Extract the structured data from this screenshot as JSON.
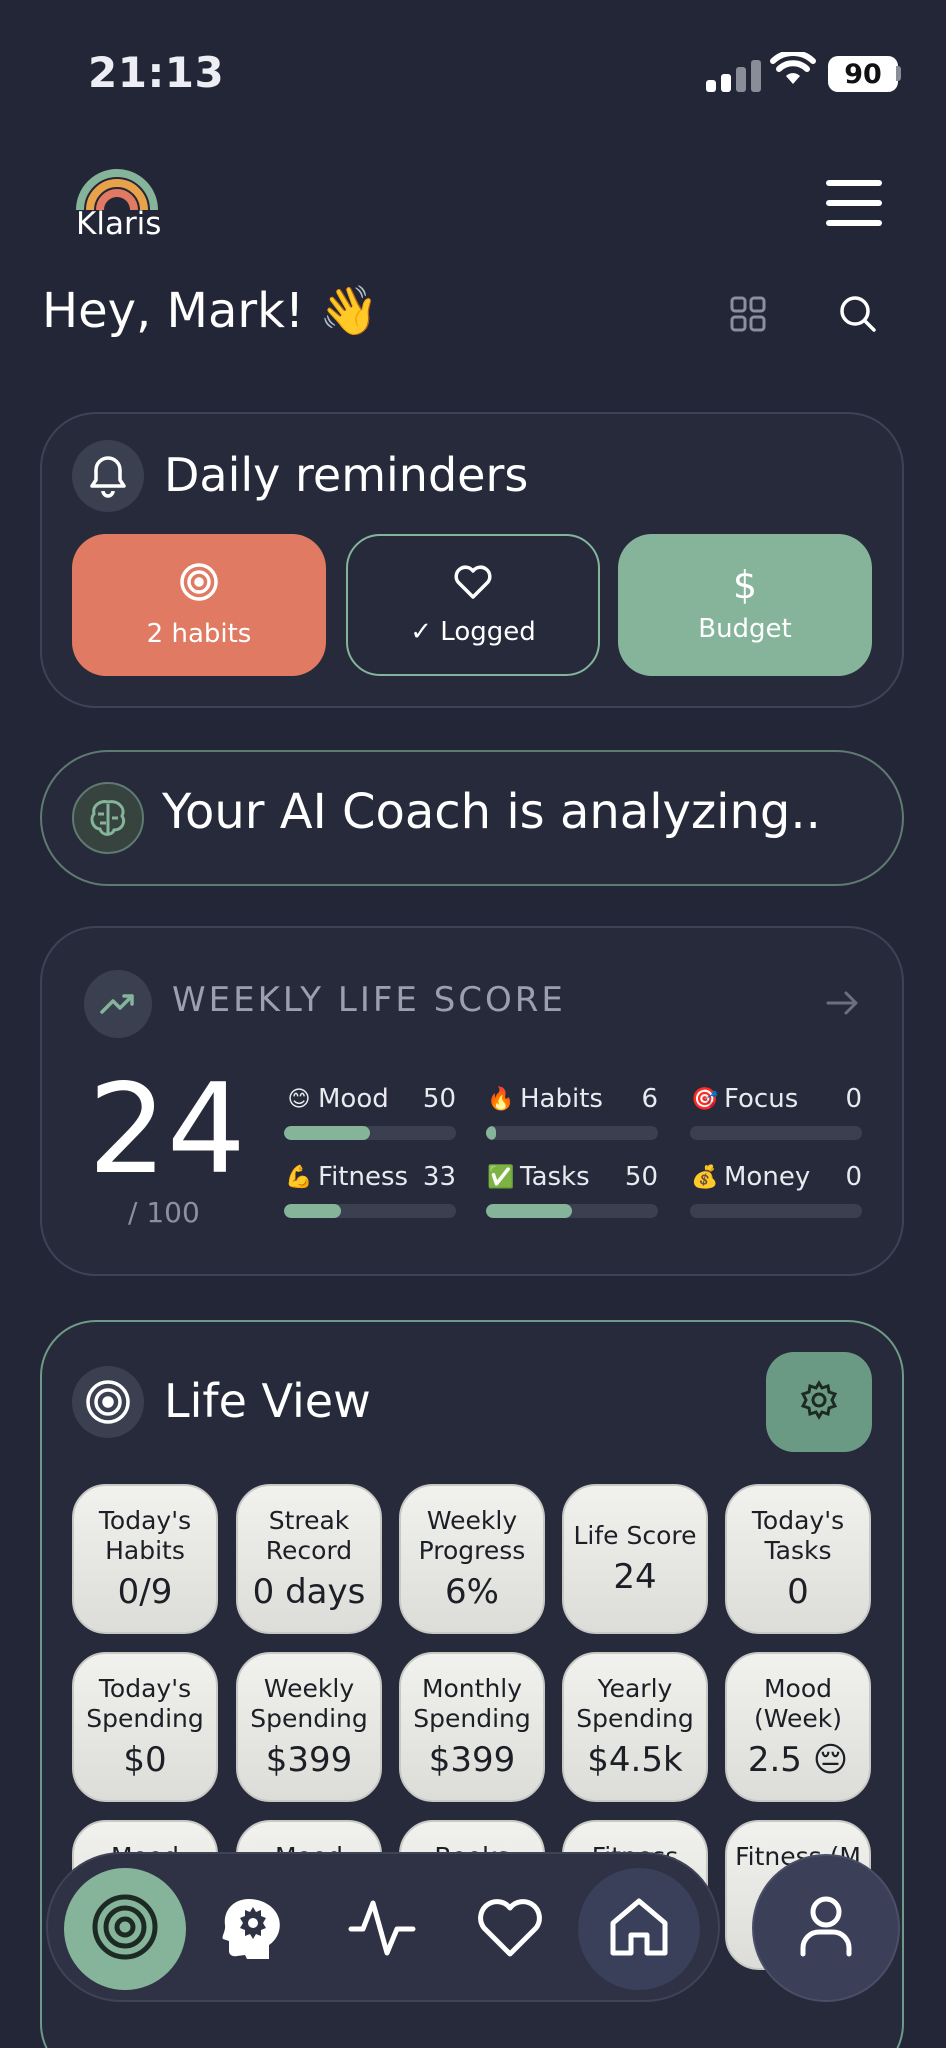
{
  "status_bar": {
    "time": "21:13",
    "battery": "90"
  },
  "header": {
    "logo_text": "Klaris",
    "greeting": "Hey, Mark! 👋"
  },
  "reminders": {
    "title": "Daily reminders",
    "buttons": [
      {
        "label": "2 habits",
        "icon": "target-icon"
      },
      {
        "label": "✓ Logged",
        "icon": "heart-icon"
      },
      {
        "label": "Budget",
        "icon": "dollar-icon"
      }
    ]
  },
  "coach": {
    "text": "Your AI Coach is analyzing.."
  },
  "weekly_score": {
    "title": "WEEKLY LIFE SCORE",
    "score": "24",
    "max": "/ 100",
    "metrics": [
      {
        "emoji": "😊",
        "label": "Mood",
        "value": "50",
        "fill": 0.5
      },
      {
        "emoji": "🔥",
        "label": "Habits",
        "value": "6",
        "fill": 0.06
      },
      {
        "emoji": "🎯",
        "label": "Focus",
        "value": "0",
        "fill": 0
      },
      {
        "emoji": "💪",
        "label": "Fitness",
        "value": "33",
        "fill": 0.33
      },
      {
        "emoji": "✅",
        "label": "Tasks",
        "value": "50",
        "fill": 0.5
      },
      {
        "emoji": "💰",
        "label": "Money",
        "value": "0",
        "fill": 0
      }
    ]
  },
  "life_view": {
    "title": "Life View",
    "tiles": [
      {
        "label": "Today's Habits",
        "value": "0/9"
      },
      {
        "label": "Streak Record",
        "value": "0 days"
      },
      {
        "label": "Weekly Progress",
        "value": "6%"
      },
      {
        "label": "Life Score",
        "value": "24"
      },
      {
        "label": "Today's Tasks",
        "value": "0"
      },
      {
        "label": "Today's Spending",
        "value": "$0"
      },
      {
        "label": "Weekly Spending",
        "value": "$399"
      },
      {
        "label": "Monthly Spending",
        "value": "$399"
      },
      {
        "label": "Yearly Spending",
        "value": "$4.5k"
      },
      {
        "label": "Mood (Week)",
        "value": "2.5 😔"
      },
      {
        "label": "Mood",
        "value": ""
      },
      {
        "label": "Mood",
        "value": ""
      },
      {
        "label": "Books",
        "value": ""
      },
      {
        "label": "Fitness",
        "value": ""
      },
      {
        "label": "Fitness (M",
        "value": ""
      }
    ]
  },
  "nav": {
    "items": [
      "target-icon",
      "brain-gear-icon",
      "activity-icon",
      "heart-icon",
      "home-icon"
    ],
    "profile": "user-icon"
  },
  "colors": {
    "background": "#232636",
    "accent_green": "#85B49B",
    "accent_orange": "#E07A63"
  }
}
